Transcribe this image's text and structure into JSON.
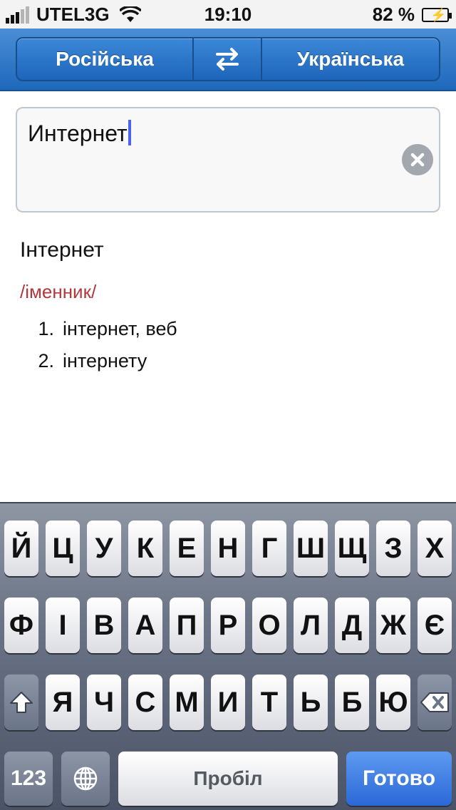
{
  "status": {
    "carrier": "UTEL3G",
    "time": "19:10",
    "battery": "82 %"
  },
  "header": {
    "source_language": "Російська",
    "swap_icon": "swap-arrows-icon",
    "target_language": "Українська"
  },
  "input": {
    "value": "Интернет",
    "clear_icon": "clear-icon"
  },
  "result": {
    "word": "Інтернет",
    "part_of_speech": "/іменник/",
    "meanings": [
      {
        "num": "1.",
        "text": "інтернет, веб"
      },
      {
        "num": "2.",
        "text": "інтернету"
      }
    ]
  },
  "keyboard": {
    "row1": [
      "Й",
      "Ц",
      "У",
      "К",
      "Е",
      "Н",
      "Г",
      "Ш",
      "Щ",
      "З",
      "Х"
    ],
    "row2": [
      "Ф",
      "І",
      "В",
      "А",
      "П",
      "Р",
      "О",
      "Л",
      "Д",
      "Ж",
      "Є"
    ],
    "row3": [
      "Я",
      "Ч",
      "С",
      "М",
      "И",
      "Т",
      "Ь",
      "Б",
      "Ю"
    ],
    "shift_icon": "shift-icon",
    "backspace_icon": "backspace-icon",
    "numbers_label": "123",
    "globe_icon": "globe-icon",
    "space_label": "Пробіл",
    "done_label": "Готово"
  }
}
